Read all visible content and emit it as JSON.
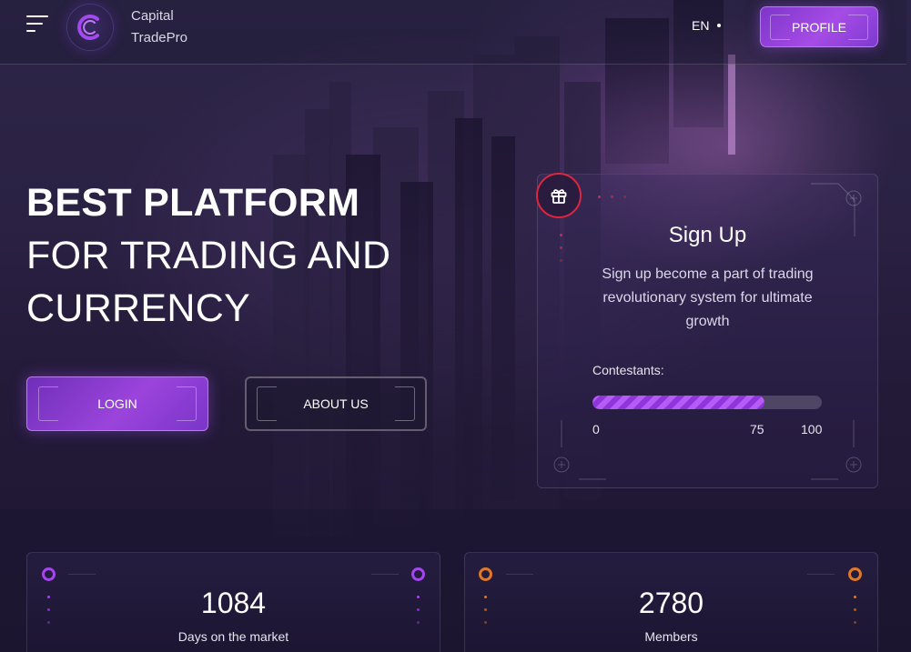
{
  "header": {
    "brand_line1": "Capital",
    "brand_line2": "TradePro",
    "language": "EN",
    "profile_label": "PROFILE"
  },
  "hero": {
    "title_bold": "BEST PLATFORM",
    "title_line2": "FOR TRADING AND",
    "title_line3": "CURRENCY",
    "login_label": "LOGIN",
    "about_label": "ABOUT US"
  },
  "signup_card": {
    "title": "Sign Up",
    "description": "Sign up become a part of trading revolutionary system for ultimate growth",
    "contestants_label": "Contestants:",
    "progress_percent": 75,
    "tick_min": "0",
    "tick_mid": "75",
    "tick_max": "100"
  },
  "stats": [
    {
      "value": "1084",
      "label": "Days on the market",
      "accent": "#a545f0"
    },
    {
      "value": "2780",
      "label": "Members",
      "accent": "#e0782a"
    }
  ],
  "colors": {
    "accent_purple": "#a545f0",
    "accent_red": "#e0253f",
    "accent_orange": "#e0782a"
  },
  "icons": [
    "menu-icon",
    "brand-logo-icon",
    "gift-icon"
  ]
}
